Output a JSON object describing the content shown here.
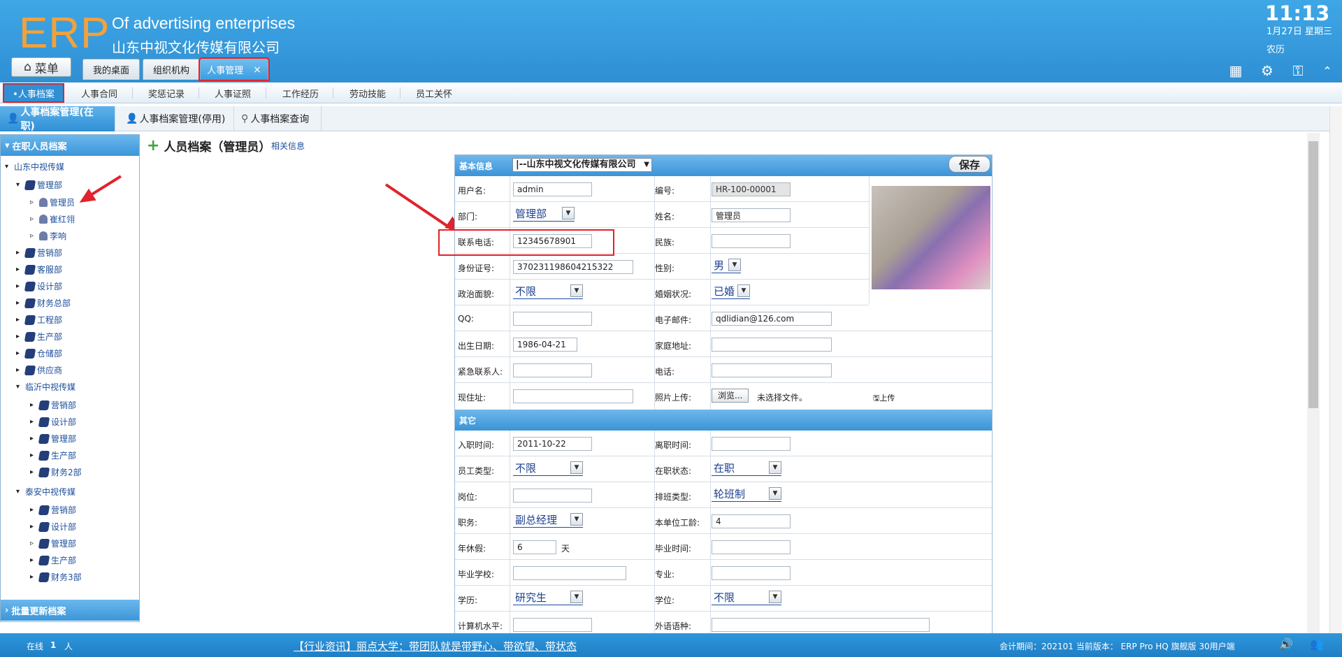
{
  "header": {
    "logo": "ERP",
    "subtitle": "Of advertising enterprises",
    "company": "山东中视文化传媒有限公司",
    "clock": "11:13",
    "date": "1月27日 星期三",
    "lunar": "农历",
    "menu_label": "菜单"
  },
  "tabs": [
    {
      "label": "我的桌面"
    },
    {
      "label": "组织机构"
    },
    {
      "label": "人事管理",
      "close": "×"
    }
  ],
  "subnav": [
    {
      "label": "•人事档案"
    },
    {
      "label": "人事合同"
    },
    {
      "label": "奖惩记录"
    },
    {
      "label": "人事证照"
    },
    {
      "label": "工作经历"
    },
    {
      "label": "劳动技能"
    },
    {
      "label": "员工关怀"
    }
  ],
  "page_tabs": [
    {
      "label": "人事档案管理(在职)"
    },
    {
      "label": "人事档案管理(停用)"
    },
    {
      "label": "人事档案查询"
    }
  ],
  "sidebar": {
    "head": "在职人员档案",
    "root": "山东中视传媒",
    "mgmt": "管理部",
    "users": [
      "管理员",
      "崔红翎",
      "李响"
    ],
    "depts1": [
      "营销部",
      "客服部",
      "设计部",
      "财务总部",
      "工程部",
      "生产部",
      "仓储部",
      "供应商"
    ],
    "linyi": "临沂中视传媒",
    "depts2": [
      "营销部",
      "设计部",
      "管理部",
      "生产部",
      "财务2部"
    ],
    "taian": "泰安中视传媒",
    "depts3": [
      "营销部",
      "设计部",
      "管理部",
      "生产部",
      "财务3部"
    ],
    "foot": "批量更新档案"
  },
  "main": {
    "title": "人员档案（管理员）",
    "related": "相关信息"
  },
  "form": {
    "section_basic": "基本信息",
    "company_select": "|--山东中视文化传媒有限公司",
    "save": "保存",
    "username_l": "用户名:",
    "username": "admin",
    "code_l": "编号:",
    "code": "HR-100-00001",
    "dept_l": "部门:",
    "dept": "管理部",
    "name_l": "姓名:",
    "name": "管理员",
    "phone_l": "联系电话:",
    "phone": "12345678901",
    "nation_l": "民族:",
    "idcard_l": "身份证号:",
    "idcard": "370231198604215322",
    "gender_l": "性别:",
    "gender": "男",
    "political_l": "政治面貌:",
    "political": "不限",
    "marital_l": "婚姻状况:",
    "marital": "已婚",
    "qq_l": "QQ:",
    "email_l": "电子邮件:",
    "email": "qdlidian@126.com",
    "birth_l": "出生日期:",
    "birth": "1986-04-21",
    "home_l": "家庭地址:",
    "emergency_l": "紧急联系人:",
    "tel_l": "电话:",
    "addr_l": "现住址:",
    "photo_l": "照片上传:",
    "browse": "浏览...",
    "nofile": "未选择文件。",
    "upload": "上传",
    "section_other": "其它",
    "join_l": "入职时间:",
    "join": "2011-10-22",
    "leave_l": "离职时间:",
    "etype_l": "员工类型:",
    "etype": "不限",
    "status_l": "在职状态:",
    "status": "在职",
    "post_l": "岗位:",
    "shift_l": "排班类型:",
    "shift": "轮班制",
    "duty_l": "职务:",
    "duty": "副总经理",
    "seniority_l": "本单位工龄:",
    "seniority": "4",
    "leave_days_l": "年休假:",
    "leave_days": "6",
    "days_unit": "天",
    "grad_time_l": "毕业时间:",
    "school_l": "毕业学校:",
    "major_l": "专业:",
    "edu_l": "学历:",
    "edu": "研究生",
    "degree_l": "学位:",
    "degree": "不限",
    "computer_l": "计算机水平:",
    "language_l": "外语语种:"
  },
  "footer": {
    "online_label": "在线",
    "online_count": "1",
    "online_unit": "人",
    "news": "【行业资讯】丽点大学：带团队就是带野心、带欲望、带状态",
    "period": "会计期间：202101 当前版本： ERP Pro HQ 旗舰版 30用户端"
  },
  "colors": {
    "header": "#3fa7e6",
    "accent": "#2f8fd4",
    "highlight": "#e0232c",
    "logo": "#f4a13b"
  }
}
